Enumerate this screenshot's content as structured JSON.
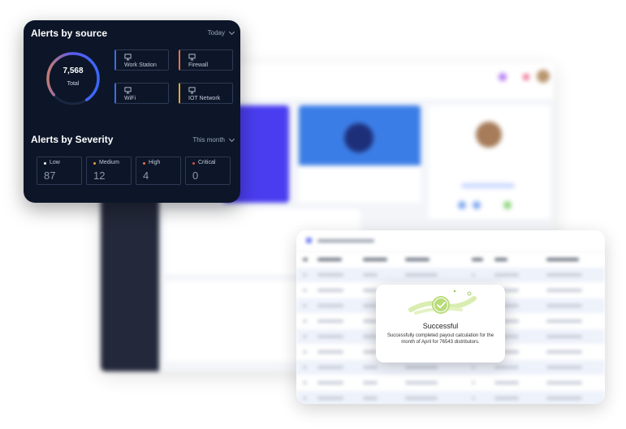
{
  "alerts_source": {
    "title": "Alerts by source",
    "filter": "Today",
    "total_value": "7,568",
    "total_label": "Total",
    "sources": [
      {
        "label": "Work Station",
        "color": "#3b6fe0",
        "icon": "monitor-icon"
      },
      {
        "label": "Firewall",
        "color": "#e8734a",
        "icon": "monitor-icon"
      },
      {
        "label": "WiFi",
        "color": "#3b6fe0",
        "icon": "monitor-icon"
      },
      {
        "label": "IOT Network",
        "color": "#e2a53a",
        "icon": "monitor-icon"
      }
    ]
  },
  "alerts_severity": {
    "title": "Alerts by Severity",
    "filter": "This month",
    "levels": [
      {
        "label": "Low",
        "value": "87",
        "color": "#ffffff"
      },
      {
        "label": "Medium",
        "value": "12",
        "color": "#e2a53a"
      },
      {
        "label": "High",
        "value": "4",
        "color": "#e8734a"
      },
      {
        "label": "Critical",
        "value": "0",
        "color": "#e04a4a"
      }
    ]
  },
  "modal": {
    "title": "Successful",
    "message": "Successfully completed payout calculation for the month of April for 76543 distributors."
  },
  "colors": {
    "panel_bg": "#0c1628",
    "ring_start": "#2f6bff",
    "ring_end": "#f08a3c",
    "success": "#8bc34a"
  }
}
